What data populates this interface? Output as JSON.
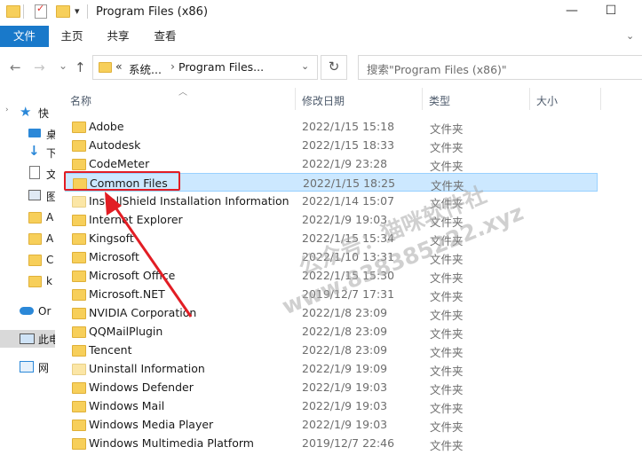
{
  "window": {
    "title": "Program Files (x86)",
    "minimize": "—",
    "maximize": "☐"
  },
  "ribbon": {
    "tabs": [
      "文件",
      "主页",
      "共享",
      "查看"
    ]
  },
  "address": {
    "prefix": "«",
    "segments": [
      "系统...",
      "Program Files..."
    ],
    "separator": "›",
    "refresh": "↻"
  },
  "search": {
    "placeholder": "搜索\"Program Files (x86)\""
  },
  "nav": {
    "back": "←",
    "forward": "→",
    "recent": "⌄",
    "up": "↑"
  },
  "sidebar": {
    "items": [
      {
        "label": "快",
        "icon": "star-icon"
      },
      {
        "label": "桌",
        "icon": "desktop-icon"
      },
      {
        "label": "下",
        "icon": "download-icon"
      },
      {
        "label": "文",
        "icon": "document-icon"
      },
      {
        "label": "图",
        "icon": "picture-icon"
      },
      {
        "label": "A",
        "icon": "folder-icon"
      },
      {
        "label": "A",
        "icon": "folder-icon"
      },
      {
        "label": "C",
        "icon": "folder-icon"
      },
      {
        "label": "k",
        "icon": "folder-icon"
      },
      {
        "label": "Or",
        "icon": "cloud-icon"
      },
      {
        "label": "此电",
        "icon": "pc-icon"
      },
      {
        "label": "网",
        "icon": "network-icon"
      }
    ]
  },
  "columns": {
    "name": "名称",
    "date": "修改日期",
    "type": "类型",
    "size": "大小"
  },
  "files": [
    {
      "name": "Adobe",
      "date": "2022/1/15 15:18",
      "type": "文件夹"
    },
    {
      "name": "Autodesk",
      "date": "2022/1/15 18:33",
      "type": "文件夹"
    },
    {
      "name": "CodeMeter",
      "date": "2022/1/9 23:28",
      "type": "文件夹"
    },
    {
      "name": "Common Files",
      "date": "2022/1/15 18:25",
      "type": "文件夹"
    },
    {
      "name": "InstallShield Installation Information",
      "date": "2022/1/14 15:07",
      "type": "文件夹"
    },
    {
      "name": "Internet Explorer",
      "date": "2022/1/9 19:03",
      "type": "文件夹"
    },
    {
      "name": "Kingsoft",
      "date": "2022/1/15 15:34",
      "type": "文件夹"
    },
    {
      "name": "Microsoft",
      "date": "2022/1/10 13:31",
      "type": "文件夹"
    },
    {
      "name": "Microsoft Office",
      "date": "2022/1/15 15:30",
      "type": "文件夹"
    },
    {
      "name": "Microsoft.NET",
      "date": "2019/12/7 17:31",
      "type": "文件夹"
    },
    {
      "name": "NVIDIA Corporation",
      "date": "2022/1/8 23:09",
      "type": "文件夹"
    },
    {
      "name": "QQMailPlugin",
      "date": "2022/1/8 23:09",
      "type": "文件夹"
    },
    {
      "name": "Tencent",
      "date": "2022/1/8 23:09",
      "type": "文件夹"
    },
    {
      "name": "Uninstall Information",
      "date": "2022/1/9 19:09",
      "type": "文件夹"
    },
    {
      "name": "Windows Defender",
      "date": "2022/1/9 19:03",
      "type": "文件夹"
    },
    {
      "name": "Windows Mail",
      "date": "2022/1/9 19:03",
      "type": "文件夹"
    },
    {
      "name": "Windows Media Player",
      "date": "2022/1/9 19:03",
      "type": "文件夹"
    },
    {
      "name": "Windows Multimedia Platform",
      "date": "2019/12/7 22:46",
      "type": "文件夹"
    }
  ],
  "selected_index": 3,
  "watermark": {
    "line1": "公众号：猫咪软件社",
    "line2": "www.838385222.xyz"
  },
  "colors": {
    "accent": "#1979ca",
    "selection": "#cce8ff",
    "highlight_box": "#e21d24"
  }
}
